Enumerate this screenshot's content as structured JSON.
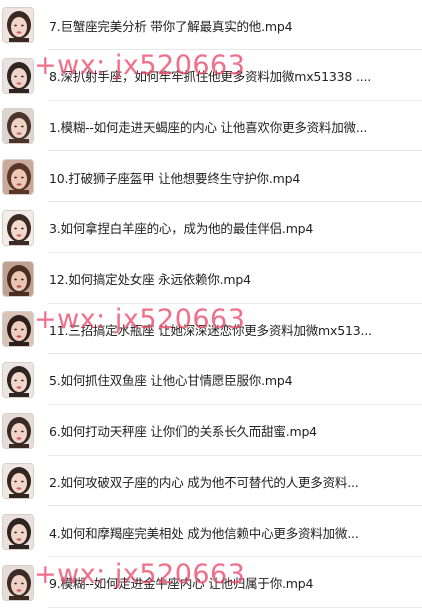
{
  "files": [
    {
      "name": "7.巨蟹座完美分析 带你了解最真实的他.mp4",
      "thumb": {
        "bg": "#efe4df",
        "hair": "#3b2a24",
        "skin": "#f2d5c8",
        "lips": "#c95a62"
      }
    },
    {
      "name": "8.深扒射手座，如何牢牢抓住他更多资料加微mx51338 ....",
      "thumb": {
        "bg": "#e8e2e4",
        "hair": "#2f2622",
        "skin": "#f0d4c9",
        "lips": "#d0606a"
      }
    },
    {
      "name": "1.模糊--如何走进天蝎座的内心 让他喜欢你更多资料加微...",
      "thumb": {
        "bg": "#dcd4cf",
        "hair": "#4a342b",
        "skin": "#efd3c6",
        "lips": "#c85c66"
      }
    },
    {
      "name": "10.打破狮子座盔甲 让他想要终生守护你.mp4",
      "thumb": {
        "bg": "#c9a99a",
        "hair": "#5a3628",
        "skin": "#ecc7b4",
        "lips": "#b84a52"
      }
    },
    {
      "name": "3.如何拿捏白羊座的心，成为他的最佳伴侣.mp4",
      "thumb": {
        "bg": "#f1ece8",
        "hair": "#3a2b25",
        "skin": "#f3d8cb",
        "lips": "#cf5d67"
      }
    },
    {
      "name": "12.如何搞定处女座 永远依赖你.mp4",
      "thumb": {
        "bg": "#bfa192",
        "hair": "#4b2e22",
        "skin": "#eac5b2",
        "lips": "#b34850"
      }
    },
    {
      "name": "11.三招搞定水瓶座 让她深深迷恋你更多资料加微mx513...",
      "thumb": {
        "bg": "#d9c2b6",
        "hair": "#2c1f1b",
        "skin": "#efcdbd",
        "lips": "#c24a58"
      }
    },
    {
      "name": "5.如何抓住双鱼座 让他心甘情愿臣服你.mp4",
      "thumb": {
        "bg": "#ece6e3",
        "hair": "#2f2622",
        "skin": "#f1d6ca",
        "lips": "#cc5b66"
      }
    },
    {
      "name": "6.如何打动天秤座 让你们的关系长久而甜蜜.mp4",
      "thumb": {
        "bg": "#e4dcd8",
        "hair": "#3a2a24",
        "skin": "#f0d3c6",
        "lips": "#c95865"
      }
    },
    {
      "name": "2.如何攻破双子座的内心 成为他不可替代的人更多资料...",
      "thumb": {
        "bg": "#eee7e3",
        "hair": "#34261f",
        "skin": "#f2d6c9",
        "lips": "#cd5e68"
      }
    },
    {
      "name": "4.如何和摩羯座完美相处 成为他信赖中心更多资料加微...",
      "thumb": {
        "bg": "#e9e1dd",
        "hair": "#2e2420",
        "skin": "#f1d5c8",
        "lips": "#ca5a65"
      }
    },
    {
      "name": "9.模糊--如何走进金牛座内心 让他归属于你.mp4",
      "thumb": {
        "bg": "#e6dcd6",
        "hair": "#3b2b24",
        "skin": "#efd1c3",
        "lips": "#c65763"
      }
    }
  ],
  "watermark": {
    "text": "+wx: jx520663",
    "color": "#ec4668"
  }
}
